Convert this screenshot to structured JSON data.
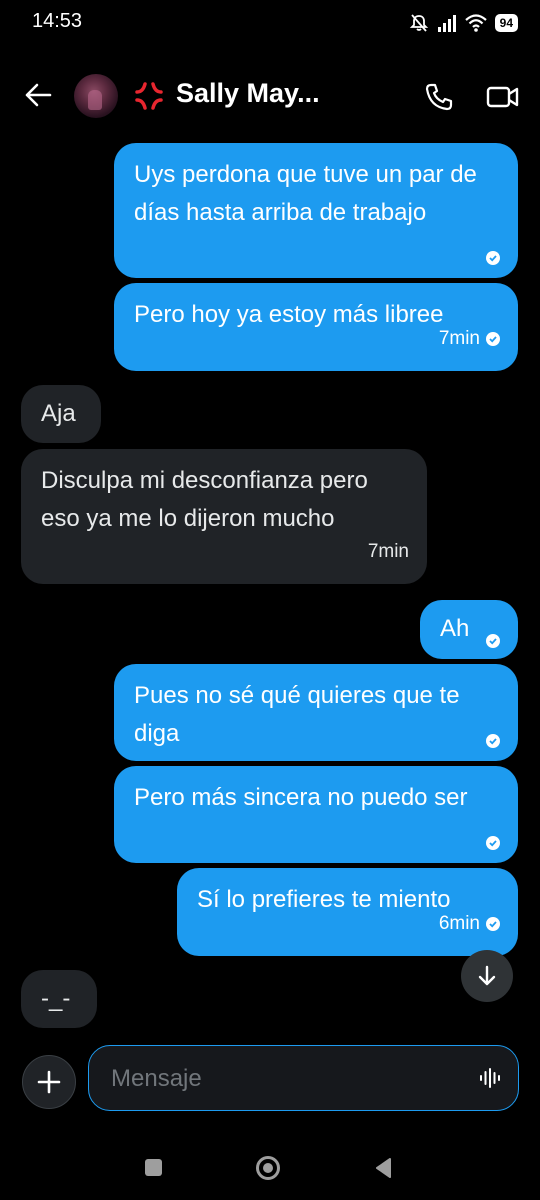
{
  "status_bar": {
    "time": "14:53",
    "battery": "94"
  },
  "header": {
    "contact_name": "Sally May...",
    "name_emoji_icon": "anger-symbol-icon"
  },
  "messages": [
    {
      "side": "sent",
      "text": "Uys perdona que tuve un par de días hasta arriba de trabajo",
      "time": "",
      "read": true
    },
    {
      "side": "sent",
      "text": "Pero hoy ya estoy más libree",
      "time": "7min",
      "read": true
    },
    {
      "side": "received",
      "text": "Aja",
      "time": ""
    },
    {
      "side": "received",
      "text": "Disculpa mi desconfianza pero eso ya me lo dijeron mucho",
      "time": "7min"
    },
    {
      "side": "sent",
      "text": "Ah",
      "time": "",
      "read": true
    },
    {
      "side": "sent",
      "text": "Pues no sé qué quieres que te diga",
      "time": "",
      "read": true
    },
    {
      "side": "sent",
      "text": "Pero más sincera no puedo ser",
      "time": "",
      "read": true
    },
    {
      "side": "sent",
      "text": "Sí lo prefieres te miento",
      "time": "6min",
      "read": true
    },
    {
      "side": "received",
      "text": "-_-",
      "time": ""
    }
  ],
  "composer": {
    "placeholder": "Mensaje"
  },
  "colors": {
    "accent": "#1d9bf0",
    "background": "#000000",
    "received_bubble": "#202327"
  }
}
